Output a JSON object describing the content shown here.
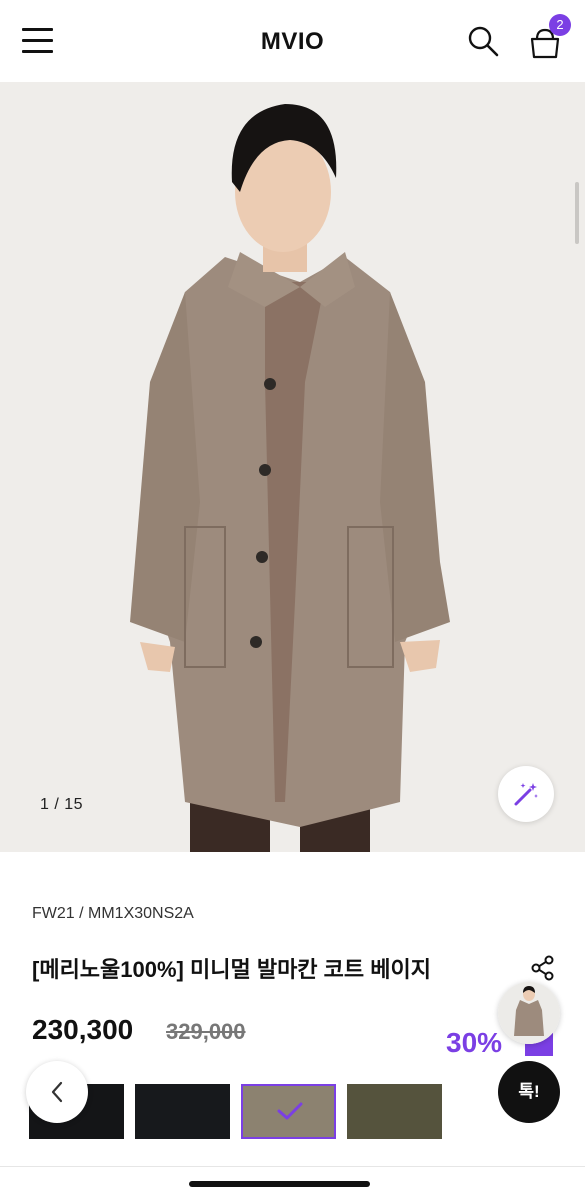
{
  "header": {
    "logo": "MVIO",
    "cart_count": "2",
    "menu_icon": "hamburger-icon",
    "search_icon": "search-icon",
    "cart_icon": "shopping-bag-icon"
  },
  "gallery": {
    "counter": "1  / 15",
    "magic_icon": "magic-wand-icon"
  },
  "product": {
    "season_code": "FW21 / MM1X30NS2A",
    "title": "[메리노울100%] 미니멀 발마칸 코트 베이지",
    "price": "230,300",
    "original_price": "329,000",
    "discount": "30%",
    "share_icon": "share-icon"
  },
  "colors": {
    "swatches": [
      "#141517",
      "#17191c",
      "#8c8270",
      "#55533d"
    ],
    "selected_index": 2,
    "accent": "#7b3fe4"
  },
  "floating": {
    "talk_label": "톡!",
    "prev_icon": "chevron-left-icon"
  }
}
